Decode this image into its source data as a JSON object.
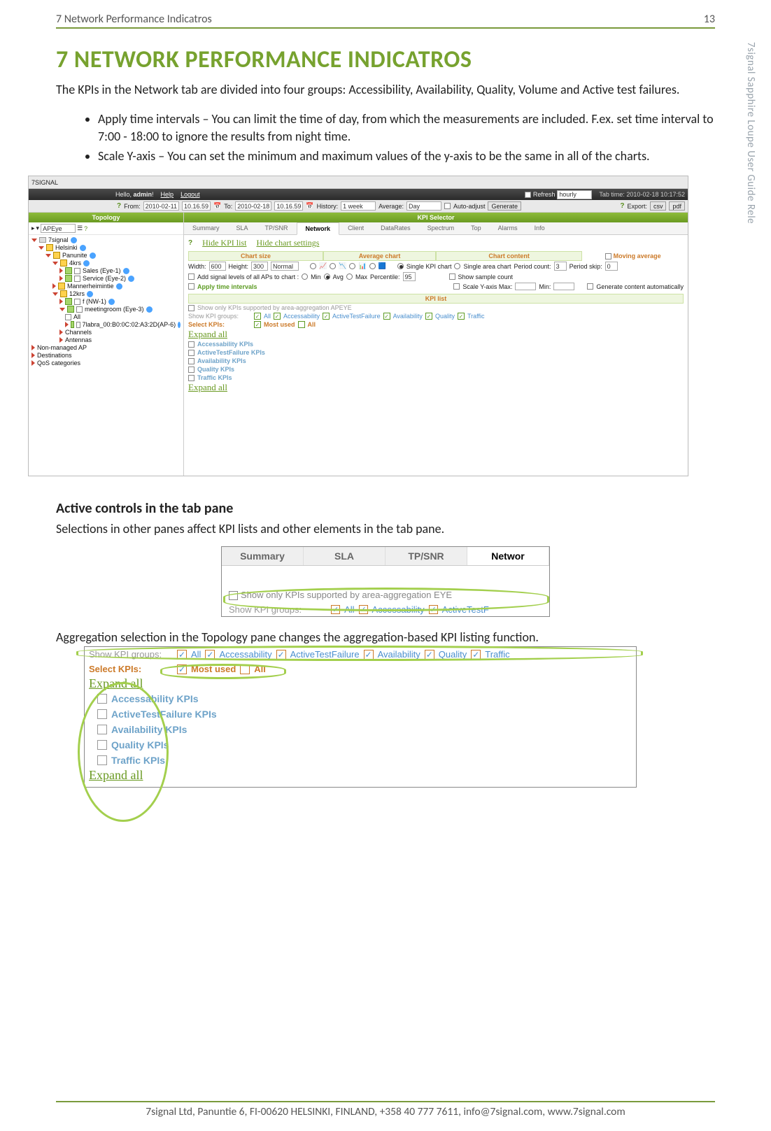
{
  "header": {
    "title": "7 Network Performance Indicatros",
    "page_no": "13"
  },
  "side_label": "7signal Sapphire Loupe User Guide Rele",
  "section": {
    "h1": "7 NETWORK PERFORMANCE INDICATROS",
    "intro": "The KPIs in the Network tab are divided into four groups: Accessibility, Availability, Quality, Volume and Active test failures.",
    "bullet1": "Apply time intervals – You can limit the time of day, from which the measurements are included. F.ex. set time interval to 7:00 - 18:00 to ignore the results from night time.",
    "bullet2": "Scale Y-axis – You can set the minimum and maximum values of the y-axis to be the same in all of the charts."
  },
  "app": {
    "logo": "7SIGNAL",
    "greet_prefix": "Hello, ",
    "greet_user": "admin",
    "sep": "!",
    "help": "Help",
    "logout": "Logout",
    "refresh_cb": "Refresh",
    "refresh_val": "hourly",
    "tab_time": "Tab time: 2010-02-18 10:17:52",
    "from_lbl": "From:",
    "from_date": "2010-02-11",
    "from_time": "10.16.59",
    "to_lbl": "To:",
    "to_date": "2010-02-18",
    "to_time": "10.16.59",
    "history_lbl": "History:",
    "history_val": "1 week",
    "average_lbl": "Average:",
    "average_val": "Day",
    "autoadjust": "Auto-adjust",
    "generate": "Generate",
    "export_lbl": "Export:",
    "csv": "csv",
    "pdf": "pdf",
    "topology": "Topology",
    "apeye": "APEye",
    "kpi_selector": "KPI Selector",
    "tabs": [
      "Summary",
      "SLA",
      "TP/SNR",
      "Network",
      "Client",
      "DataRates",
      "Spectrum",
      "Top",
      "Alarms",
      "Info"
    ],
    "hide_kpi": "Hide KPI list",
    "hide_chart": "Hide chart settings",
    "chart_size": "Chart size",
    "avg_chart": "Average chart",
    "chart_content": "Chart content",
    "moving_avg": "Moving average",
    "width_lbl": "Width:",
    "width_val": "600",
    "height_lbl": "Height:",
    "height_val": "300",
    "normal": "Normal",
    "single_kpi": "Single KPI chart",
    "single_area": "Single area chart",
    "period_count_lbl": "Period count:",
    "period_count_val": "3",
    "period_skip_lbl": "Period skip:",
    "period_skip_val": "0",
    "add_signal": "Add signal levels of all APs to chart :",
    "min": "Min",
    "avg": "Avg",
    "max": "Max",
    "percentile_lbl": "Percentile:",
    "percentile_val": "95",
    "show_sample": "Show sample count",
    "apply_intervals": "Apply time intervals",
    "scale_y_lbl": "Scale Y-axis Max:",
    "min_lbl": "Min:",
    "gen_auto": "Generate content automatically",
    "kpi_list": "KPI list",
    "show_only": "Show only KPIs supported by area-aggregation APEYE",
    "show_groups": "Show KPI groups:",
    "grp_all": "All",
    "grp_acc": "Accessability",
    "grp_atf": "ActiveTestFailure",
    "grp_avail": "Availability",
    "grp_qual": "Quality",
    "grp_traf": "Traffic",
    "select_kpis": "Select KPIs:",
    "most_used": "Most used",
    "expand_all": "Expand all",
    "cat_acc": "Accessability KPIs",
    "cat_atf": "ActiveTestFailure KPIs",
    "cat_avail": "Availability KPIs",
    "cat_qual": "Quality KPIs",
    "cat_traf": "Traffic KPIs",
    "tree": {
      "root": "7signal",
      "l1": "Helsinki",
      "l2": "Panunite",
      "g1": "4krs",
      "g1a": "Sales (Eye-1)",
      "g1b": "Service (Eye-2)",
      "g2": "Mannerheimintie",
      "g3": "12krs",
      "g3a": "f (NW-1)",
      "g3b": "meetingroom (Eye-3)",
      "g3c": "All",
      "g3d": "7labra_00:B0:0C:02:A3:2D(AP-6)",
      "ch": "Channels",
      "ant": "Antennas",
      "nm": "Non-managed AP",
      "dest": "Destinations",
      "qos": "QoS categories"
    }
  },
  "sub1": {
    "h": "Active controls in the tab pane",
    "p": "Selections in other panes affect KPI lists and other elements in the tab pane."
  },
  "snip2": {
    "tabs": [
      "Summary",
      "SLA",
      "TP/SNR",
      "Networ"
    ],
    "line1": "Show only KPIs supported by area-aggregation EYE",
    "line2_lbl": "Show KPI groups:",
    "all": "All",
    "acc": "Accessability",
    "atf": "ActiveTestF"
  },
  "sub2": {
    "p": "Aggregation selection in the Topology pane changes the aggregation-based KPI listing function."
  },
  "panel3": {
    "show_groups": "Show KPI groups:",
    "all": "All",
    "acc": "Accessability",
    "atf": "ActiveTestFailure",
    "avail": "Availability",
    "qual": "Quality",
    "traf": "Traffic",
    "select_kpis": "Select KPIs:",
    "most_used": "Most used",
    "expand_all": "Expand all",
    "cats": [
      "Accessability KPIs",
      "ActiveTestFailure KPIs",
      "Availability KPIs",
      "Quality KPIs",
      "Traffic KPIs"
    ]
  },
  "footer": "7signal Ltd, Panuntie 6, FI-00620 HELSINKI, FINLAND, +358 40 777 7611, info@7signal.com, www.7signal.com"
}
